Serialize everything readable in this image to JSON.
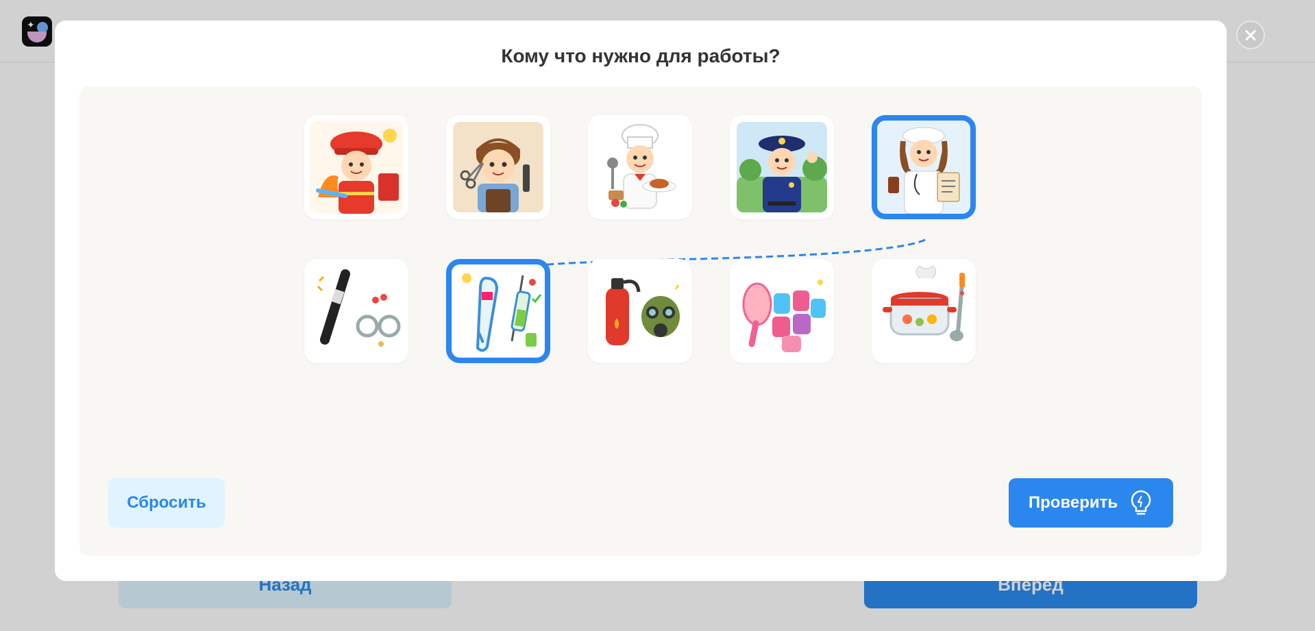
{
  "background": {
    "back_label": "Назад",
    "next_label": "Вперед"
  },
  "modal": {
    "title": "Кому что нужно для работы?",
    "top_row": [
      {
        "name": "firefighter",
        "selected": false
      },
      {
        "name": "hairdresser",
        "selected": false
      },
      {
        "name": "chef",
        "selected": false
      },
      {
        "name": "police-officer",
        "selected": false
      },
      {
        "name": "doctor",
        "selected": true
      }
    ],
    "bottom_row": [
      {
        "name": "baton-handcuffs",
        "selected": false
      },
      {
        "name": "thermometer-syringe",
        "selected": true
      },
      {
        "name": "extinguisher-gasmask",
        "selected": false
      },
      {
        "name": "brush-curlers",
        "selected": false
      },
      {
        "name": "pot-ladle",
        "selected": false
      }
    ],
    "connections": [
      {
        "from": "doctor",
        "to": "thermometer-syringe"
      }
    ],
    "reset_label": "Сбросить",
    "check_label": "Проверить",
    "check_icon": "lightbulb-icon"
  },
  "colors": {
    "accent": "#2b86ee",
    "light_accent": "#dff4ff",
    "board": "#f8f7f4"
  }
}
